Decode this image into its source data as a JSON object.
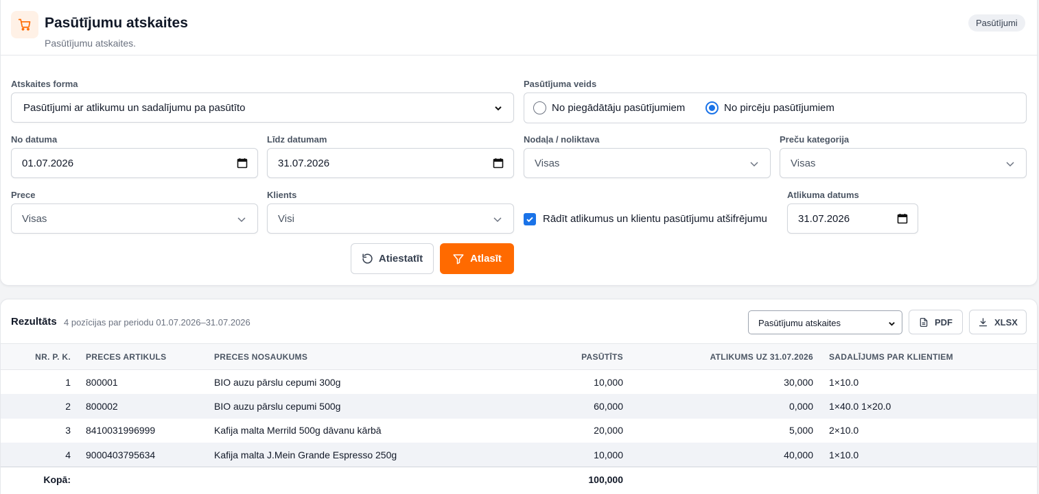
{
  "header": {
    "title": "Pasūtījumu atskaites",
    "subtitle": "Pasūtījumu atskaites.",
    "badge": "Pasūtījumi",
    "icon": "shopping-cart-icon",
    "accent": "#ff6a00"
  },
  "filters": {
    "report_form": {
      "label": "Atskaites forma",
      "value": "Pasūtījumi ar atlikumu un sadalījumu pa pasūtīto"
    },
    "order_type": {
      "label": "Pasūtījuma veids",
      "options": [
        {
          "label": "No piegādātāju pasūtījumiem",
          "selected": false
        },
        {
          "label": "No pircēju pasūtījumiem",
          "selected": true
        }
      ]
    },
    "date_from": {
      "label": "No datuma",
      "value": "01.07.2026"
    },
    "date_to": {
      "label": "Līdz datumam",
      "value": "31.07.2026"
    },
    "department": {
      "label": "Nodaļa / noliktava",
      "value": "Visas"
    },
    "category": {
      "label": "Preču kategorija",
      "value": "Visas"
    },
    "product": {
      "label": "Prece",
      "value": "Visas"
    },
    "client": {
      "label": "Klients",
      "value": "Visi"
    },
    "show_balances": {
      "label": "Rādīt atlikumus un klientu pasūtījumu atšifrējumu",
      "checked": true
    },
    "balance_date": {
      "label": "Atlikuma datums",
      "value": "31.07.2026"
    },
    "reset_label": "Atiestatīt",
    "apply_label": "Atlasīt"
  },
  "results": {
    "title": "Rezultāts",
    "summary": "4 pozīcijas par periodu 01.07.2026–31.07.2026",
    "report_select": "Pasūtījumu atskaites",
    "pdf_label": "PDF",
    "xlsx_label": "XLSX",
    "columns": [
      "NR. P. K.",
      "PRECES ARTIKULS",
      "PRECES NOSAUKUMS",
      "PASŪTĪTS",
      "ATLIKUMS UZ 31.07.2026",
      "SADALĪJUMS PAR KLIENTIEM"
    ],
    "rows": [
      {
        "nr": "1",
        "sku": "800001",
        "name": "BIO auzu pārslu cepumi 300g",
        "ordered": "10,000",
        "balance": "30,000",
        "split": "1×10.0"
      },
      {
        "nr": "2",
        "sku": "800002",
        "name": "BIO auzu pārslu cepumi 500g",
        "ordered": "60,000",
        "balance": "0,000",
        "split": "1×40.0 1×20.0"
      },
      {
        "nr": "3",
        "sku": "8410031996999",
        "name": "Kafija malta Merrild 500g dāvanu kārbā",
        "ordered": "20,000",
        "balance": "5,000",
        "split": "2×10.0"
      },
      {
        "nr": "4",
        "sku": "9000403795634",
        "name": "Kafija malta J.Mein Grande Espresso 250g",
        "ordered": "10,000",
        "balance": "40,000",
        "split": "1×10.0"
      }
    ],
    "total_label": "Kopā:",
    "total_ordered": "100,000"
  }
}
